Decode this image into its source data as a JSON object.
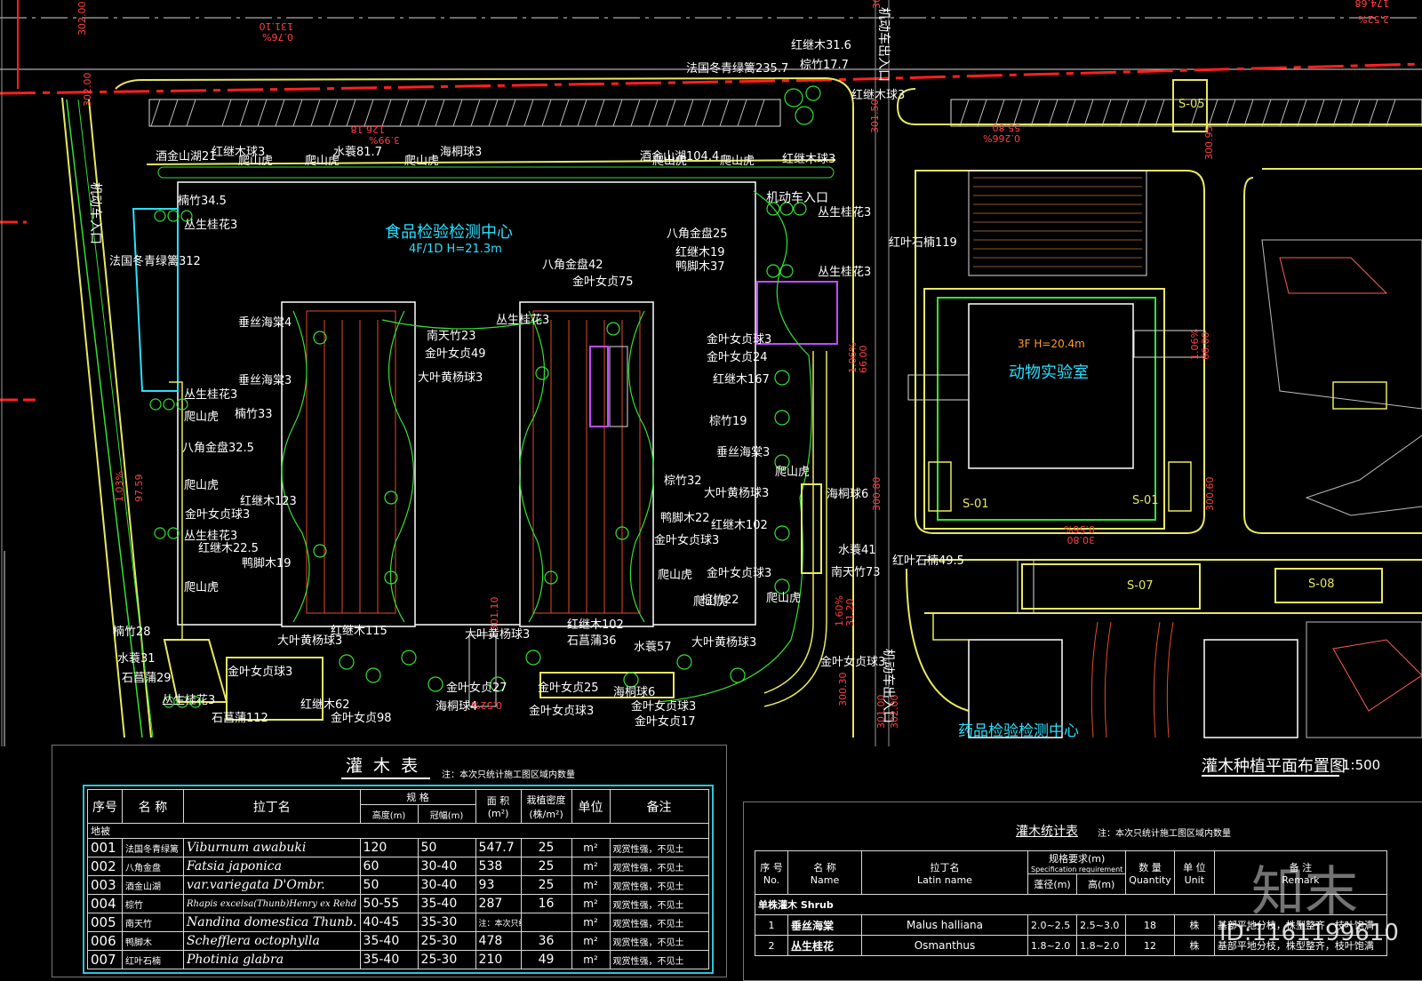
{
  "plan": {
    "title_text": "灌木种植平面布置图",
    "scale_text": "1:500",
    "buildings": [
      {
        "name": "食品检验检测中心",
        "info": "4F/1D H=21.3m"
      },
      {
        "name": "动物实验室",
        "info": "3F H=20.4m"
      },
      {
        "name": "药品检验检测中心",
        "info": ""
      }
    ],
    "entrances": [
      "机动车入口",
      "机动车入口",
      "机动车出入口",
      "机动车出入口"
    ],
    "zones": [
      "S-05",
      "S-01",
      "S-01",
      "S-07",
      "S-08"
    ],
    "plant_labels": [
      "法国冬青绿篱235.7",
      "红继木31.6",
      "棕竹17.7",
      "红继木球3",
      "法国冬青绿篱312",
      "楠竹34.5",
      "丛生桂花3",
      "酒金山湖21",
      "红继木球3",
      "爬山虎",
      "爬山虎",
      "水蓑81.7",
      "爬山虎",
      "海桐球3",
      "酒金山湖104.4",
      "爬山虎",
      "爬山虎",
      "红继木球3",
      "八角金盘25",
      "红继木19",
      "鸭脚木37",
      "丛生桂花3",
      "丛生桂花3",
      "八角金盘42",
      "金叶女贞75",
      "红叶石楠119",
      "垂丝海棠4",
      "垂丝海棠3",
      "楠竹33",
      "丛生桂花3",
      "爬山虎",
      "八角金盘32.5",
      "爬山虎",
      "红继木123",
      "金叶女贞球3",
      "丛生桂花3",
      "红继木22.5",
      "鸭脚木19",
      "爬山虎",
      "南天竹23",
      "金叶女贞49",
      "大叶黄杨球3",
      "丛生桂花3",
      "金叶女贞球3",
      "金叶女贞24",
      "红继木167",
      "棕竹19",
      "垂丝海棠3",
      "爬山虎",
      "海桐球6",
      "棕竹32",
      "大叶黄杨球3",
      "鸭脚木22",
      "金叶女贞球3",
      "红继木102",
      "金叶女贞球3",
      "棕竹22",
      "爬山虎",
      "水蓑41",
      "南天竹73",
      "红叶石楠49.5",
      "楠竹28",
      "水蓑31",
      "石菖蒲29",
      "丛生桂花3",
      "石菖蒲112",
      "红继木62",
      "金叶女贞98",
      "金叶女贞球3",
      "红继木115",
      "大叶黄杨球3",
      "大叶黄杨球3",
      "金叶女贞27",
      "海桐球4",
      "金叶女贞25",
      "金叶女贞球3",
      "红继木102",
      "石菖蒲36",
      "水蓑57",
      "海桐球6",
      "金叶女贞球3",
      "金叶女贞17",
      "大叶黄杨球3",
      "金叶女贞球3",
      "爬山虎",
      "爬山虎"
    ],
    "dims": [
      "131.10",
      "0.76%",
      "302.00",
      "301.50",
      "302.00",
      "126.18",
      "3.99%",
      "55.80",
      "0.266%",
      "301.50",
      "300.95",
      "174.68",
      "2.52%",
      "1.03%",
      "97.59",
      "1.06%",
      "66.00",
      "1.06%",
      "66.00",
      "1.60%",
      "31.20",
      "300.30",
      "300.80",
      "300.60",
      "0.56%",
      "30.80",
      "0.52%",
      "302.00",
      "301.00",
      "301.10"
    ]
  },
  "table1": {
    "title": "灌 木 表",
    "note": "注：本次只统计施工图区域内数量",
    "headers": {
      "no": "序号",
      "name": "名 称",
      "latin": "拉丁名",
      "spec": "规 格",
      "dia": "高度(m)",
      "crown": "冠幅(m)",
      "area": "面 积 (m²)",
      "density": "栽植密度 (株/m²)",
      "unit": "单位",
      "remark": "备注"
    },
    "section": "地被",
    "rows": [
      {
        "no": "001",
        "name": "法国冬青绿篱",
        "latin": "Viburnum awabuki",
        "h": "120",
        "w": "50",
        "area": "547.7",
        "density": "25",
        "unit": "m²",
        "remark": "观赏性强，不见土"
      },
      {
        "no": "002",
        "name": "八角金盘",
        "latin": "Fatsia japonica",
        "h": "60",
        "w": "30-40",
        "area": "538",
        "density": "25",
        "unit": "m²",
        "remark": "观赏性强，不见土"
      },
      {
        "no": "003",
        "name": "酒金山湖",
        "latin": "var.variegata D'Ombr.",
        "h": "50",
        "w": "30-40",
        "area": "93",
        "density": "25",
        "unit": "m²",
        "remark": "观赏性强，不见土"
      },
      {
        "no": "004",
        "name": "棕竹",
        "latin": "Rhapis excelsa(Thunb)Henry ex Rehd",
        "h": "50-55",
        "w": "35-40",
        "area": "287",
        "density": "16",
        "unit": "m²",
        "remark": "观赏性强，不见土"
      },
      {
        "no": "005",
        "name": "南天竹",
        "latin": "Nandina domestica Thunb.",
        "h": "40-45",
        "w": "35-30",
        "area": "注：本次只统计施工图区域内数量",
        "density": "",
        "unit": "m²",
        "remark": "观赏性强，不见土"
      },
      {
        "no": "006",
        "name": "鸭脚木",
        "latin": "Schefflera octophylla",
        "h": "35-40",
        "w": "25-30",
        "area": "478",
        "density": "36",
        "unit": "m²",
        "remark": "观赏性强，不见土"
      },
      {
        "no": "007",
        "name": "红叶石楠",
        "latin": "Photinia glabra",
        "h": "35-40",
        "w": "25-30",
        "area": "210",
        "density": "49",
        "unit": "m²",
        "remark": "观赏性强，不见土"
      }
    ]
  },
  "table2": {
    "title": "灌木统计表",
    "note": "注：本次只统计施工图区域内数量",
    "headers": {
      "no": "序 号",
      "no_en": "No.",
      "name": "名 称",
      "name_en": "Name",
      "latin": "拉丁名",
      "latin_en": "Latin name",
      "spec": "规格要求(m)",
      "spec_en": "Specification requirement",
      "dia": "蓬径(m)",
      "height": "高(m)",
      "qty": "数 量",
      "qty_en": "Quantity",
      "unit": "单 位",
      "unit_en": "Unit",
      "remark": "备 注",
      "remark_en": "Remark"
    },
    "section": "单株灌木  Shrub",
    "rows": [
      {
        "no": "1",
        "name": "垂丝海棠",
        "latin": "Malus halliana",
        "dia": "2.0~2.5",
        "h": "2.5~3.0",
        "qty": "18",
        "unit": "株",
        "remark": "基部平地分枝，株型整齐，枝叶饱满"
      },
      {
        "no": "2",
        "name": "丛生桂花",
        "latin": "Osmanthus",
        "dia": "1.8~2.0",
        "h": "1.8~2.0",
        "qty": "12",
        "unit": "株",
        "remark": "基部平地分枝，株型整齐，枝叶饱满"
      }
    ]
  },
  "watermark": {
    "brand": "知末",
    "id": "ID:1161199610"
  }
}
